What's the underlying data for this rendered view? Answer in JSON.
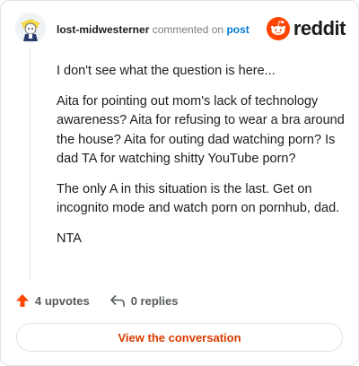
{
  "header": {
    "username": "lost-midwesterner",
    "action_text": "commented on",
    "target_link": "post",
    "brand_name": "reddit"
  },
  "comment": {
    "paragraphs": [
      "I don't see what the question is here...",
      "Aita for pointing out mom's lack of technology awareness? Aita for refusing to wear a bra around the house? Aita for outing dad watching porn? Is dad TA for watching shitty YouTube porn?",
      "The only A in this situation is the last. Get on incognito mode and watch porn on pornhub, dad.",
      "NTA"
    ]
  },
  "actions": {
    "upvotes": "4 upvotes",
    "replies": "0 replies"
  },
  "footer": {
    "view_button": "View the conversation"
  },
  "colors": {
    "accent": "#d93a00",
    "upvote": "#ff4500",
    "link": "#0079d3"
  },
  "icons": {
    "upvote": "upvote-arrow-icon",
    "reply": "reply-arrow-icon",
    "brand": "reddit-snoo-icon"
  }
}
